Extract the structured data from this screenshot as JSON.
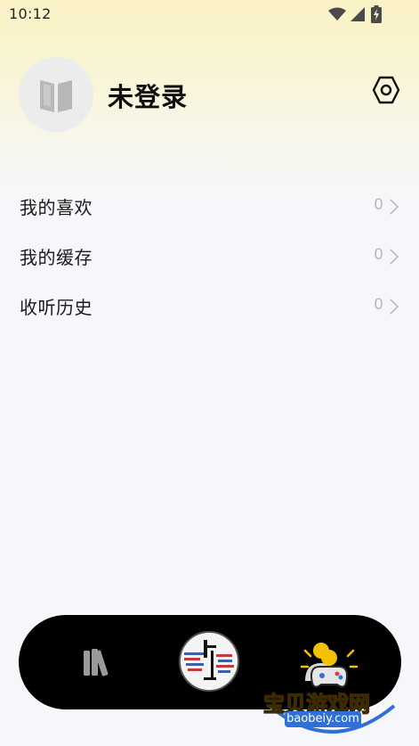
{
  "status_bar": {
    "time": "10:12",
    "icons": [
      "wifi-icon",
      "cellular-signal-icon",
      "battery-charging-icon"
    ]
  },
  "header": {
    "avatar_icon": "book-icon",
    "username": "未登录",
    "settings_icon": "hexagon-settings-icon"
  },
  "menu": {
    "items": [
      {
        "label": "我的喜欢",
        "count": "0"
      },
      {
        "label": "我的缓存",
        "count": "0"
      },
      {
        "label": "收听历史",
        "count": "0"
      }
    ],
    "chevron_icon": "chevron-right-icon"
  },
  "bottom_nav": {
    "items": [
      {
        "name": "library",
        "icon": "bookshelf-icon"
      },
      {
        "name": "now-playing",
        "icon": "album-cover"
      },
      {
        "name": "profile",
        "icon": "person-icon"
      }
    ]
  },
  "watermark": {
    "text": "宝贝游戏网",
    "url": "baobeiy.com"
  },
  "colors": {
    "background_top": "#faf2c4",
    "background": "#f6f7fb",
    "nav_background": "#000000",
    "count_text": "#b8b8b8",
    "watermark_yellow": "#ffcf1a",
    "watermark_blue": "#2f6fd6"
  }
}
